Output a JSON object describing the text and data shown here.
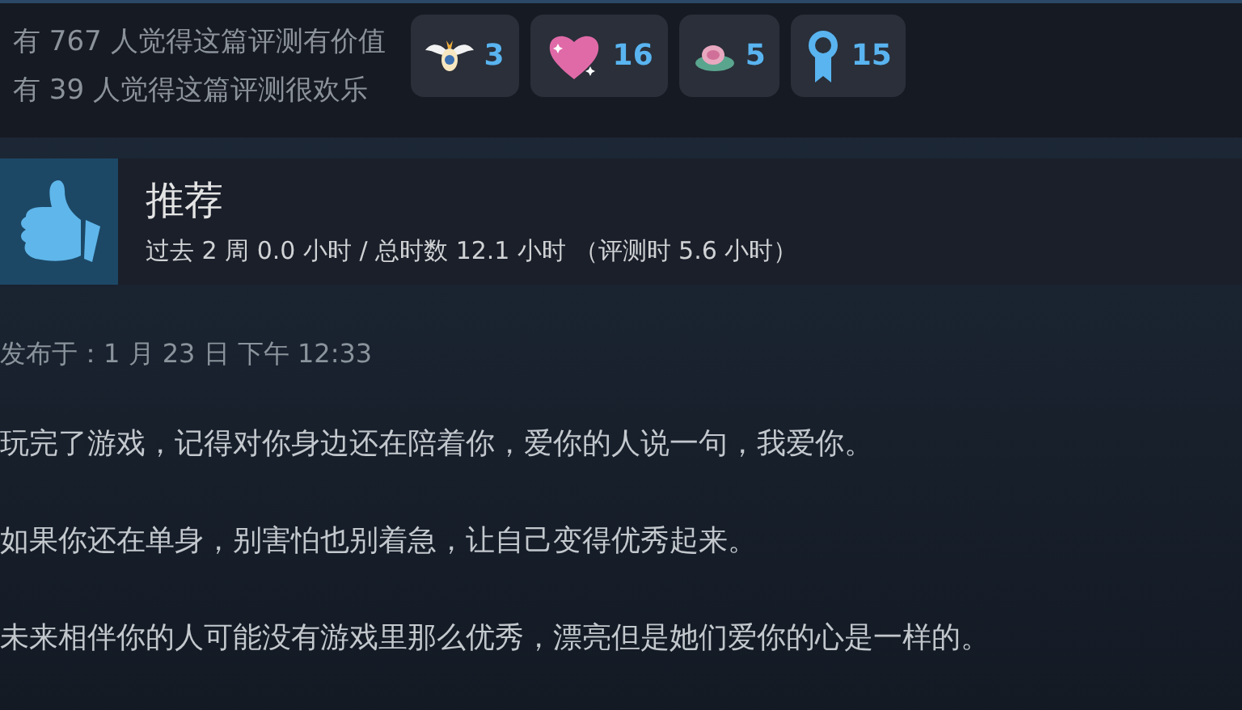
{
  "helpful": [
    "有 767 人觉得这篇评测有价值",
    "有 39 人觉得这篇评测很欢乐"
  ],
  "awards": [
    {
      "count": "3"
    },
    {
      "count": "16"
    },
    {
      "count": "5"
    },
    {
      "count": "15"
    }
  ],
  "review": {
    "verdict": "推荐",
    "recommended": true,
    "playtime": "过去 2 周 0.0 小时 / 总时数 12.1 小时 （评测时 5.6 小时）",
    "posted": "发布于：1 月 23 日 下午 12:33",
    "paragraphs": [
      "玩完了游戏，记得对你身边还在陪着你，爱你的人说一句，我爱你。",
      "如果你还在单身，别害怕也别着急，让自己变得优秀起来。",
      "未来相伴你的人可能没有游戏里那么优秀，漂亮但是她们爱你的心是一样的。"
    ]
  }
}
